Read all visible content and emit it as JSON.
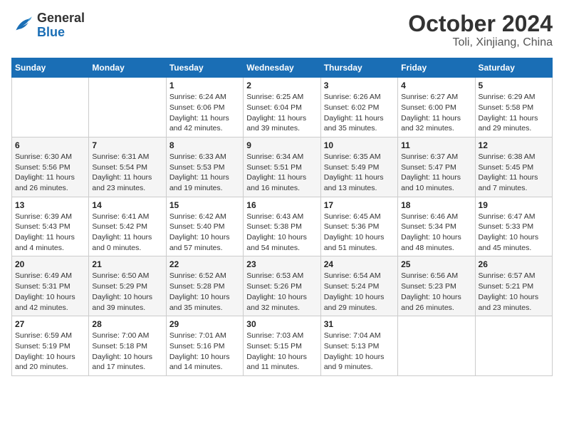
{
  "header": {
    "logo_line1": "General",
    "logo_line2": "Blue",
    "title": "October 2024",
    "subtitle": "Toli, Xinjiang, China"
  },
  "weekdays": [
    "Sunday",
    "Monday",
    "Tuesday",
    "Wednesday",
    "Thursday",
    "Friday",
    "Saturday"
  ],
  "weeks": [
    [
      {
        "day": "",
        "sunrise": "",
        "sunset": "",
        "daylight": ""
      },
      {
        "day": "",
        "sunrise": "",
        "sunset": "",
        "daylight": ""
      },
      {
        "day": "1",
        "sunrise": "Sunrise: 6:24 AM",
        "sunset": "Sunset: 6:06 PM",
        "daylight": "Daylight: 11 hours and 42 minutes."
      },
      {
        "day": "2",
        "sunrise": "Sunrise: 6:25 AM",
        "sunset": "Sunset: 6:04 PM",
        "daylight": "Daylight: 11 hours and 39 minutes."
      },
      {
        "day": "3",
        "sunrise": "Sunrise: 6:26 AM",
        "sunset": "Sunset: 6:02 PM",
        "daylight": "Daylight: 11 hours and 35 minutes."
      },
      {
        "day": "4",
        "sunrise": "Sunrise: 6:27 AM",
        "sunset": "Sunset: 6:00 PM",
        "daylight": "Daylight: 11 hours and 32 minutes."
      },
      {
        "day": "5",
        "sunrise": "Sunrise: 6:29 AM",
        "sunset": "Sunset: 5:58 PM",
        "daylight": "Daylight: 11 hours and 29 minutes."
      }
    ],
    [
      {
        "day": "6",
        "sunrise": "Sunrise: 6:30 AM",
        "sunset": "Sunset: 5:56 PM",
        "daylight": "Daylight: 11 hours and 26 minutes."
      },
      {
        "day": "7",
        "sunrise": "Sunrise: 6:31 AM",
        "sunset": "Sunset: 5:54 PM",
        "daylight": "Daylight: 11 hours and 23 minutes."
      },
      {
        "day": "8",
        "sunrise": "Sunrise: 6:33 AM",
        "sunset": "Sunset: 5:53 PM",
        "daylight": "Daylight: 11 hours and 19 minutes."
      },
      {
        "day": "9",
        "sunrise": "Sunrise: 6:34 AM",
        "sunset": "Sunset: 5:51 PM",
        "daylight": "Daylight: 11 hours and 16 minutes."
      },
      {
        "day": "10",
        "sunrise": "Sunrise: 6:35 AM",
        "sunset": "Sunset: 5:49 PM",
        "daylight": "Daylight: 11 hours and 13 minutes."
      },
      {
        "day": "11",
        "sunrise": "Sunrise: 6:37 AM",
        "sunset": "Sunset: 5:47 PM",
        "daylight": "Daylight: 11 hours and 10 minutes."
      },
      {
        "day": "12",
        "sunrise": "Sunrise: 6:38 AM",
        "sunset": "Sunset: 5:45 PM",
        "daylight": "Daylight: 11 hours and 7 minutes."
      }
    ],
    [
      {
        "day": "13",
        "sunrise": "Sunrise: 6:39 AM",
        "sunset": "Sunset: 5:43 PM",
        "daylight": "Daylight: 11 hours and 4 minutes."
      },
      {
        "day": "14",
        "sunrise": "Sunrise: 6:41 AM",
        "sunset": "Sunset: 5:42 PM",
        "daylight": "Daylight: 11 hours and 0 minutes."
      },
      {
        "day": "15",
        "sunrise": "Sunrise: 6:42 AM",
        "sunset": "Sunset: 5:40 PM",
        "daylight": "Daylight: 10 hours and 57 minutes."
      },
      {
        "day": "16",
        "sunrise": "Sunrise: 6:43 AM",
        "sunset": "Sunset: 5:38 PM",
        "daylight": "Daylight: 10 hours and 54 minutes."
      },
      {
        "day": "17",
        "sunrise": "Sunrise: 6:45 AM",
        "sunset": "Sunset: 5:36 PM",
        "daylight": "Daylight: 10 hours and 51 minutes."
      },
      {
        "day": "18",
        "sunrise": "Sunrise: 6:46 AM",
        "sunset": "Sunset: 5:34 PM",
        "daylight": "Daylight: 10 hours and 48 minutes."
      },
      {
        "day": "19",
        "sunrise": "Sunrise: 6:47 AM",
        "sunset": "Sunset: 5:33 PM",
        "daylight": "Daylight: 10 hours and 45 minutes."
      }
    ],
    [
      {
        "day": "20",
        "sunrise": "Sunrise: 6:49 AM",
        "sunset": "Sunset: 5:31 PM",
        "daylight": "Daylight: 10 hours and 42 minutes."
      },
      {
        "day": "21",
        "sunrise": "Sunrise: 6:50 AM",
        "sunset": "Sunset: 5:29 PM",
        "daylight": "Daylight: 10 hours and 39 minutes."
      },
      {
        "day": "22",
        "sunrise": "Sunrise: 6:52 AM",
        "sunset": "Sunset: 5:28 PM",
        "daylight": "Daylight: 10 hours and 35 minutes."
      },
      {
        "day": "23",
        "sunrise": "Sunrise: 6:53 AM",
        "sunset": "Sunset: 5:26 PM",
        "daylight": "Daylight: 10 hours and 32 minutes."
      },
      {
        "day": "24",
        "sunrise": "Sunrise: 6:54 AM",
        "sunset": "Sunset: 5:24 PM",
        "daylight": "Daylight: 10 hours and 29 minutes."
      },
      {
        "day": "25",
        "sunrise": "Sunrise: 6:56 AM",
        "sunset": "Sunset: 5:23 PM",
        "daylight": "Daylight: 10 hours and 26 minutes."
      },
      {
        "day": "26",
        "sunrise": "Sunrise: 6:57 AM",
        "sunset": "Sunset: 5:21 PM",
        "daylight": "Daylight: 10 hours and 23 minutes."
      }
    ],
    [
      {
        "day": "27",
        "sunrise": "Sunrise: 6:59 AM",
        "sunset": "Sunset: 5:19 PM",
        "daylight": "Daylight: 10 hours and 20 minutes."
      },
      {
        "day": "28",
        "sunrise": "Sunrise: 7:00 AM",
        "sunset": "Sunset: 5:18 PM",
        "daylight": "Daylight: 10 hours and 17 minutes."
      },
      {
        "day": "29",
        "sunrise": "Sunrise: 7:01 AM",
        "sunset": "Sunset: 5:16 PM",
        "daylight": "Daylight: 10 hours and 14 minutes."
      },
      {
        "day": "30",
        "sunrise": "Sunrise: 7:03 AM",
        "sunset": "Sunset: 5:15 PM",
        "daylight": "Daylight: 10 hours and 11 minutes."
      },
      {
        "day": "31",
        "sunrise": "Sunrise: 7:04 AM",
        "sunset": "Sunset: 5:13 PM",
        "daylight": "Daylight: 10 hours and 9 minutes."
      },
      {
        "day": "",
        "sunrise": "",
        "sunset": "",
        "daylight": ""
      },
      {
        "day": "",
        "sunrise": "",
        "sunset": "",
        "daylight": ""
      }
    ]
  ]
}
